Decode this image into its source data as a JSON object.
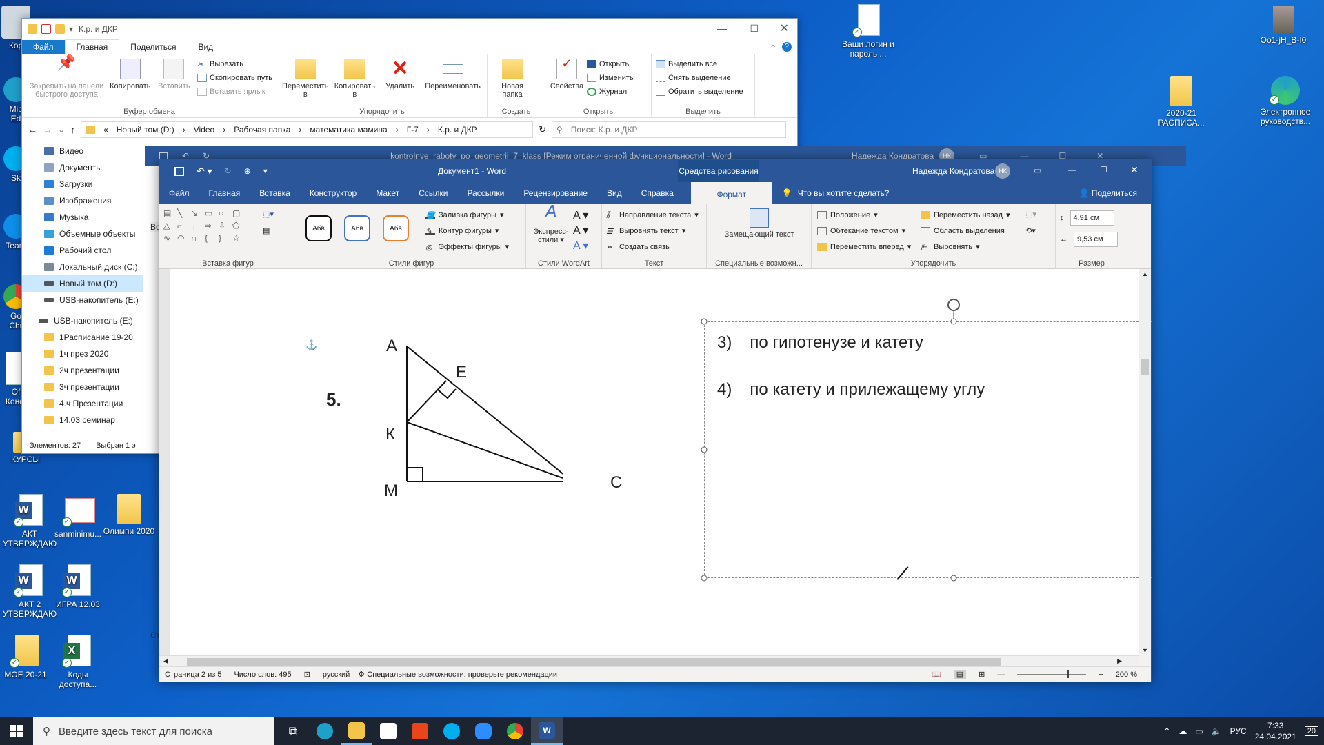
{
  "desktop": {
    "left_icons": [
      {
        "label": "Кор"
      },
      {
        "label": "Mic\nEd"
      },
      {
        "label": "Sk"
      },
      {
        "label": "Team"
      },
      {
        "label": "Go\nChr"
      },
      {
        "label": "Оf\nКонф"
      },
      {
        "label": "КУРСЫ"
      },
      {
        "label": "АКТ УТВЕРЖДАЮ"
      },
      {
        "label": "sanminimu..."
      },
      {
        "label": "Олимпи 2020"
      },
      {
        "label": "АКТ 2 УТВЕРЖДАЮ"
      },
      {
        "label": "ИГРА 12.03"
      },
      {
        "label": "МОЕ 20-21"
      },
      {
        "label": "Коды доступа..."
      }
    ],
    "right_icons": [
      {
        "label": "Ваши логин и пароль ..."
      },
      {
        "label": "Оо1-jH_B-I0"
      },
      {
        "label": "2020-21 РАСПИСА..."
      },
      {
        "label": "Электронное руководств..."
      }
    ]
  },
  "explorer": {
    "title": "К.р. и ДКР",
    "tabs": [
      "Файл",
      "Главная",
      "Поделиться",
      "Вид"
    ],
    "active_tab": "Главная",
    "ribbon": {
      "clipboard": {
        "pin": "Закрепить на панели быстрого доступа",
        "copy": "Копировать",
        "paste": "Вставить",
        "cut": "Вырезать",
        "copy_path": "Скопировать путь",
        "paste_shortcut": "Вставить ярлык",
        "group": "Буфер обмена"
      },
      "organize": {
        "move": "Переместить в",
        "copyto": "Копировать в",
        "delete": "Удалить",
        "rename": "Переименовать",
        "group": "Упорядочить"
      },
      "create": {
        "new_folder": "Новая папка",
        "group": "Создать"
      },
      "open": {
        "properties": "Свойства",
        "open": "Открыть",
        "edit": "Изменить",
        "history": "Журнал",
        "group": "Открыть"
      },
      "select": {
        "all": "Выделить все",
        "none": "Снять выделение",
        "invert": "Обратить выделение",
        "group": "Выделить"
      }
    },
    "breadcrumb": [
      "Новый том (D:)",
      "Video",
      "Рабочая папка",
      "математика мамина",
      "Г-7",
      "К.р. и ДКР"
    ],
    "breadcrumb_prefix": "«",
    "search_placeholder": "Поиск: К.р. и ДКР",
    "nav": [
      {
        "label": "Видео",
        "color": "#4a6fa5"
      },
      {
        "label": "Документы",
        "color": "#8fa3c0"
      },
      {
        "label": "Загрузки",
        "color": "#2f7fd6"
      },
      {
        "label": "Изображения",
        "color": "#5b8fc9"
      },
      {
        "label": "Музыка",
        "color": "#3a78c9"
      },
      {
        "label": "Объемные объекты",
        "color": "#3aa0d8"
      },
      {
        "label": "Рабочий стол",
        "color": "#1f7ad6"
      },
      {
        "label": "Локальный диск (C:)",
        "color": "#7a8a99"
      },
      {
        "label": "Новый том (D:)",
        "color": "#555"
      },
      {
        "label": "USB-накопитель (E:)",
        "color": "#555"
      },
      {
        "label": "USB-накопитель (E:)",
        "color": "#555"
      },
      {
        "label": "1Расписание 19-20",
        "color": "#f2c54a"
      },
      {
        "label": "1ч през 2020",
        "color": "#f2c54a"
      },
      {
        "label": "2ч презентации",
        "color": "#f2c54a"
      },
      {
        "label": "3ч презентации",
        "color": "#f2c54a"
      },
      {
        "label": "4.ч   Презентации",
        "color": "#f2c54a"
      },
      {
        "label": "14.03 семинар",
        "color": "#f2c54a"
      }
    ],
    "status_items": "Элементов: 27",
    "status_selected": "Выбран 1 э"
  },
  "bg_word": {
    "title": "kontrolnye_raboty_po_geometrii_7_klass [Режим ограниченной функциональности] - Word",
    "user": "Надежда Кондратова",
    "initials": "НК",
    "side_letters": [
      "Ф",
      "Во",
      "Ст"
    ]
  },
  "word": {
    "title": "Документ1 - Word",
    "context_tab": "Средства рисования",
    "user": "Надежда Кондратова",
    "initials": "НК",
    "tabs": [
      "Файл",
      "Главная",
      "Вставка",
      "Конструктор",
      "Макет",
      "Ссылки",
      "Рассылки",
      "Рецензирование",
      "Вид",
      "Справка",
      "Формат"
    ],
    "active_tab": "Формат",
    "tell_me": "Что вы хотите сделать?",
    "share": "Поделиться",
    "ribbon": {
      "insert_shapes": "Вставка фигур",
      "shape_styles": "Стили фигур",
      "style_sample": "Абв",
      "fill": "Заливка фигуры",
      "outline": "Контур фигуры",
      "effects": "Эффекты фигуры",
      "wordart_express": "Экспресс-стили",
      "wordart_group": "Стили WordArt",
      "text_direction": "Направление текста",
      "align_text": "Выровнять текст",
      "create_link": "Создать связь",
      "text_group": "Текст",
      "alt_text": "Замещающий текст",
      "accessibility_group": "Специальные возможн...",
      "position": "Положение",
      "wrap": "Обтекание текстом",
      "bring_forward": "Переместить вперед",
      "send_backward": "Переместить назад",
      "selection_pane": "Область выделения",
      "align": "Выровнять",
      "arrange_group": "Упорядочить",
      "height": "4,91 см",
      "width": "9,53 см",
      "size_group": "Размер"
    },
    "doc": {
      "problem_number": "5.",
      "labels": {
        "A": "А",
        "E": "Е",
        "K": "К",
        "M": "М",
        "C": "С"
      },
      "options": [
        {
          "num": "3)",
          "text": "по гипотенузе и катету"
        },
        {
          "num": "4)",
          "text": "по катету и прилежащему углу"
        }
      ]
    },
    "status": {
      "page": "Страница 2 из 5",
      "words": "Число слов: 495",
      "lang": "русский",
      "accessibility": "Специальные возможности: проверьте рекомендации",
      "zoom": "200 %"
    }
  },
  "taskbar": {
    "search_placeholder": "Введите здесь текст для поиска",
    "apps": [
      {
        "name": "task-view",
        "color": "#ffffff"
      },
      {
        "name": "edge",
        "color": "#1fa0c9"
      },
      {
        "name": "explorer",
        "color": "#f2c54a"
      },
      {
        "name": "store",
        "color": "#ffffff"
      },
      {
        "name": "office",
        "color": "#e8451c"
      },
      {
        "name": "skype",
        "color": "#00aff0"
      },
      {
        "name": "zoom",
        "color": "#2d8cff"
      },
      {
        "name": "chrome",
        "color": "#e94235"
      },
      {
        "name": "word",
        "color": "#2b579a"
      }
    ],
    "lang": "РУС",
    "time": "7:33",
    "date": "24.04.2021",
    "notifications": "20"
  }
}
